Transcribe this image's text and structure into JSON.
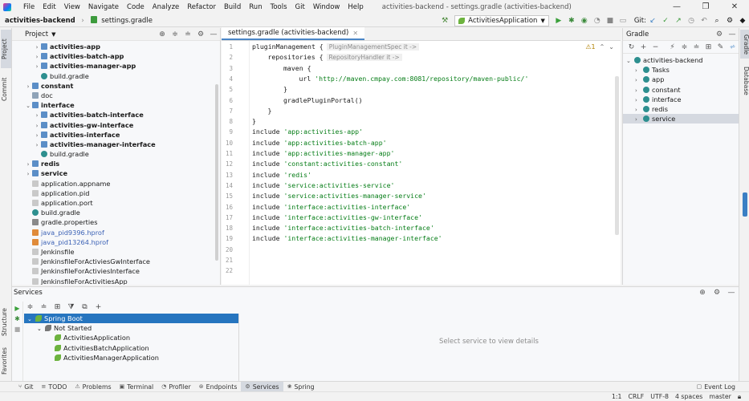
{
  "title_bar": {
    "menu": [
      "File",
      "Edit",
      "View",
      "Navigate",
      "Code",
      "Analyze",
      "Refactor",
      "Build",
      "Run",
      "Tools",
      "Git",
      "Window",
      "Help"
    ],
    "window_title": "activities-backend - settings.gradle (activities-backend)",
    "controls": [
      "—",
      "❐",
      "✕"
    ]
  },
  "nav_bar": {
    "project": "activities-backend",
    "file": "settings.gradle",
    "run_config": "ActivitiesApplication",
    "git_label": "Git:"
  },
  "left_tool_tabs": [
    "Project",
    "Commit"
  ],
  "project_panel": {
    "title": "Project",
    "rows": [
      {
        "indent": 2,
        "arrow": "›",
        "icon": "module",
        "label": "activities-app",
        "style": "bold"
      },
      {
        "indent": 2,
        "arrow": "›",
        "icon": "module",
        "label": "activities-batch-app",
        "style": "bold"
      },
      {
        "indent": 2,
        "arrow": "›",
        "icon": "module",
        "label": "activities-manager-app",
        "style": "bold"
      },
      {
        "indent": 2,
        "arrow": "",
        "icon": "gradle",
        "label": "build.gradle",
        "style": ""
      },
      {
        "indent": 1,
        "arrow": "›",
        "icon": "module",
        "label": "constant",
        "style": "bold"
      },
      {
        "indent": 1,
        "arrow": "",
        "icon": "folder",
        "label": "doc",
        "style": ""
      },
      {
        "indent": 1,
        "arrow": "⌄",
        "icon": "module",
        "label": "interface",
        "style": "bold"
      },
      {
        "indent": 2,
        "arrow": "›",
        "icon": "module",
        "label": "activities-batch-interface",
        "style": "bold"
      },
      {
        "indent": 2,
        "arrow": "›",
        "icon": "module",
        "label": "activities-gw-interface",
        "style": "bold"
      },
      {
        "indent": 2,
        "arrow": "›",
        "icon": "module",
        "label": "activities-interface",
        "style": "bold"
      },
      {
        "indent": 2,
        "arrow": "›",
        "icon": "module",
        "label": "activities-manager-interface",
        "style": "bold"
      },
      {
        "indent": 2,
        "arrow": "",
        "icon": "gradle",
        "label": "build.gradle",
        "style": ""
      },
      {
        "indent": 1,
        "arrow": "›",
        "icon": "module",
        "label": "redis",
        "style": "bold"
      },
      {
        "indent": 1,
        "arrow": "›",
        "icon": "module",
        "label": "service",
        "style": "bold"
      },
      {
        "indent": 1,
        "arrow": "",
        "icon": "file",
        "label": "application.appname",
        "style": ""
      },
      {
        "indent": 1,
        "arrow": "",
        "icon": "file",
        "label": "application.pid",
        "style": ""
      },
      {
        "indent": 1,
        "arrow": "",
        "icon": "file",
        "label": "application.port",
        "style": ""
      },
      {
        "indent": 1,
        "arrow": "",
        "icon": "gradle",
        "label": "build.gradle",
        "style": ""
      },
      {
        "indent": 1,
        "arrow": "",
        "icon": "prop",
        "label": "gradle.properties",
        "style": ""
      },
      {
        "indent": 1,
        "arrow": "",
        "icon": "hprof",
        "label": "java_pid9396.hprof",
        "style": "blue"
      },
      {
        "indent": 1,
        "arrow": "",
        "icon": "hprof",
        "label": "java_pid13264.hprof",
        "style": "blue"
      },
      {
        "indent": 1,
        "arrow": "",
        "icon": "file",
        "label": "Jenkinsfile",
        "style": ""
      },
      {
        "indent": 1,
        "arrow": "",
        "icon": "file",
        "label": "JenkinsfileForActiviesGwInterface",
        "style": ""
      },
      {
        "indent": 1,
        "arrow": "",
        "icon": "file",
        "label": "JenkinsfileForActiviesInterface",
        "style": ""
      },
      {
        "indent": 1,
        "arrow": "",
        "icon": "file",
        "label": "JenkinsfileForActivitiesApp",
        "style": ""
      }
    ]
  },
  "editor": {
    "tab": "settings.gradle (activities-backend)",
    "warnings": "⚠1",
    "lines": [
      {
        "n": "1",
        "indent": 0,
        "text": "pluginManagement {",
        "hint": "PluginManagementSpec it ->"
      },
      {
        "n": "2",
        "indent": 1,
        "text": "repositories {",
        "hint": "RepositoryHandler it ->"
      },
      {
        "n": "3",
        "indent": 2,
        "text": "maven {",
        "hint": ""
      },
      {
        "n": "4",
        "indent": 3,
        "pre": "url ",
        "str": "'http://maven.cmpay.com:8081/repository/maven-public/'",
        "hint": ""
      },
      {
        "n": "5",
        "indent": 2,
        "text": "}",
        "hint": ""
      },
      {
        "n": "6",
        "indent": 2,
        "text": "gradlePluginPortal()",
        "hint": ""
      },
      {
        "n": "7",
        "indent": 1,
        "text": "}",
        "hint": ""
      },
      {
        "n": "8",
        "indent": 0,
        "text": "}",
        "hint": ""
      },
      {
        "n": "9",
        "indent": 0,
        "pre": "include ",
        "str": "'app:activities-app'",
        "hint": ""
      },
      {
        "n": "10",
        "indent": 0,
        "pre": "include ",
        "str": "'app:activities-batch-app'",
        "hint": ""
      },
      {
        "n": "11",
        "indent": 0,
        "pre": "include ",
        "str": "'app:activities-manager-app'",
        "hint": ""
      },
      {
        "n": "12",
        "indent": 0,
        "pre": "include ",
        "str": "'constant:activities-constant'",
        "hint": ""
      },
      {
        "n": "13",
        "indent": 0,
        "pre": "include ",
        "str": "'redis'",
        "hint": ""
      },
      {
        "n": "14",
        "indent": 0,
        "pre": "include ",
        "str": "'service:activities-service'",
        "hint": ""
      },
      {
        "n": "15",
        "indent": 0,
        "pre": "include ",
        "str": "'service:activities-manager-service'",
        "hint": ""
      },
      {
        "n": "16",
        "indent": 0,
        "pre": "include ",
        "str": "'interface:activities-interface'",
        "hint": ""
      },
      {
        "n": "17",
        "indent": 0,
        "pre": "include ",
        "str": "'interface:activities-gw-interface'",
        "hint": ""
      },
      {
        "n": "18",
        "indent": 0,
        "pre": "include ",
        "str": "'interface:activities-batch-interface'",
        "hint": ""
      },
      {
        "n": "19",
        "indent": 0,
        "pre": "include ",
        "str": "'interface:activities-manager-interface'",
        "hint": ""
      },
      {
        "n": "20",
        "indent": 0,
        "text": "",
        "hint": ""
      },
      {
        "n": "21",
        "indent": 0,
        "text": "",
        "hint": ""
      },
      {
        "n": "22",
        "indent": 0,
        "text": "",
        "hint": ""
      }
    ]
  },
  "gradle_panel": {
    "title": "Gradle",
    "rows": [
      {
        "indent": 0,
        "arrow": "⌄",
        "label": "activities-backend",
        "selected": false
      },
      {
        "indent": 1,
        "arrow": "›",
        "label": "Tasks",
        "selected": false
      },
      {
        "indent": 1,
        "arrow": "›",
        "label": "app",
        "selected": false
      },
      {
        "indent": 1,
        "arrow": "›",
        "label": "constant",
        "selected": false
      },
      {
        "indent": 1,
        "arrow": "›",
        "label": "interface",
        "selected": false
      },
      {
        "indent": 1,
        "arrow": "›",
        "label": "redis",
        "selected": false
      },
      {
        "indent": 1,
        "arrow": "›",
        "label": "service",
        "selected": true
      }
    ]
  },
  "right_tool_tabs": [
    "Gradle",
    "Database"
  ],
  "services_panel": {
    "title": "Services",
    "rows": [
      {
        "indent": 0,
        "arrow": "⌄",
        "label": "Spring Boot",
        "selected": true
      },
      {
        "indent": 1,
        "arrow": "⌄",
        "label": "Not Started",
        "selected": false
      },
      {
        "indent": 2,
        "arrow": "",
        "label": "ActivitiesApplication",
        "selected": false
      },
      {
        "indent": 2,
        "arrow": "",
        "label": "ActivitiesBatchApplication",
        "selected": false
      },
      {
        "indent": 2,
        "arrow": "",
        "label": "ActivitiesManagerApplication",
        "selected": false
      }
    ],
    "empty_message": "Select service to view details",
    "side_tabs": [
      "Structure",
      "Favorites"
    ]
  },
  "bottom_tools": [
    {
      "label": "Git",
      "active": false
    },
    {
      "label": "TODO",
      "active": false
    },
    {
      "label": "Problems",
      "active": false
    },
    {
      "label": "Terminal",
      "active": false
    },
    {
      "label": "Profiler",
      "active": false
    },
    {
      "label": "Endpoints",
      "active": false
    },
    {
      "label": "Services",
      "active": true
    },
    {
      "label": "Spring",
      "active": false
    }
  ],
  "event_log": "Event Log",
  "status_bar": [
    "1:1",
    "CRLF",
    "UTF-8",
    "4 spaces",
    "master"
  ],
  "colors": {
    "accent": "#2675bf",
    "string": "#067d17",
    "selection": "#d5d9e0"
  }
}
